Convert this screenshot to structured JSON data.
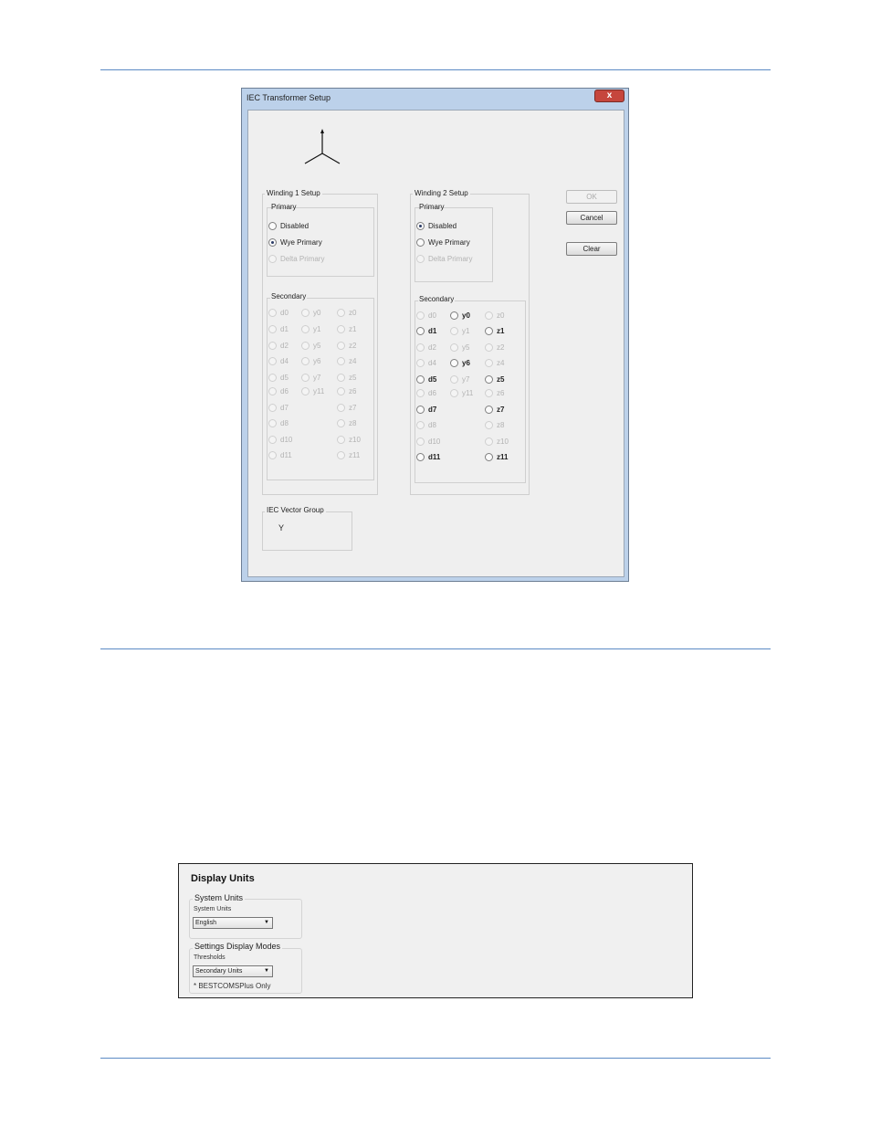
{
  "dialog": {
    "title": "IEC Transformer Setup",
    "close_glyph": "x",
    "buttons": {
      "ok": "OK",
      "cancel": "Cancel",
      "clear": "Clear"
    }
  },
  "winding1": {
    "title": "Winding 1 Setup",
    "primary_label": "Primary",
    "primary_options": [
      {
        "label": "Disabled",
        "checked": false,
        "enabled": true
      },
      {
        "label": "Wye Primary",
        "checked": true,
        "enabled": true
      },
      {
        "label": "Delta Primary",
        "checked": false,
        "enabled": false
      }
    ],
    "secondary_label": "Secondary",
    "d": [
      "d0",
      "d1",
      "d2",
      "d4",
      "d5",
      "d6",
      "d7",
      "d8",
      "d10",
      "d11"
    ],
    "y": [
      "y0",
      "y1",
      "y5",
      "y6",
      "y7",
      "y11"
    ],
    "z": [
      "z0",
      "z1",
      "z2",
      "z4",
      "z5",
      "z6",
      "z7",
      "z8",
      "z10",
      "z11"
    ]
  },
  "winding2": {
    "title": "Winding 2 Setup",
    "primary_label": "Primary",
    "primary_options": [
      {
        "label": "Disabled",
        "checked": true,
        "enabled": true
      },
      {
        "label": "Wye Primary",
        "checked": false,
        "enabled": true
      },
      {
        "label": "Delta Primary",
        "checked": false,
        "enabled": false
      }
    ],
    "secondary_label": "Secondary",
    "d": [
      "d0",
      "d1",
      "d2",
      "d4",
      "d5",
      "d6",
      "d7",
      "d8",
      "d10",
      "d11"
    ],
    "y": [
      "y0",
      "y1",
      "y5",
      "y6",
      "y7",
      "y11"
    ],
    "z": [
      "z0",
      "z1",
      "z2",
      "z4",
      "z5",
      "z6",
      "z7",
      "z8",
      "z10",
      "z11"
    ],
    "enabled": [
      "d1",
      "d5",
      "d7",
      "d11",
      "y0",
      "y6",
      "z1",
      "z5",
      "z7",
      "z11"
    ]
  },
  "vector_group": {
    "title": "IEC Vector Group",
    "value": "Y"
  },
  "display_units": {
    "title": "Display Units",
    "system_units": {
      "group_title": "System Units",
      "field_label": "System Units",
      "value": "English"
    },
    "settings_modes": {
      "group_title": "Settings Display Modes",
      "field_label": "Thresholds",
      "value": "Secondary Units"
    },
    "footnote": "* BESTCOMSPlus Only"
  }
}
